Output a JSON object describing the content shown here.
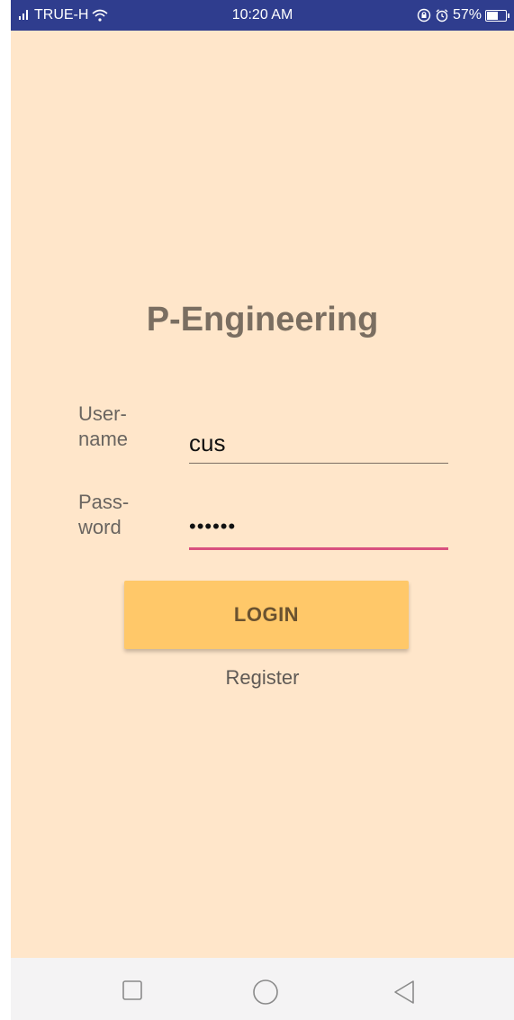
{
  "status_bar": {
    "carrier": "TRUE-H",
    "time": "10:20 AM",
    "battery": "57%",
    "icons": [
      "signal-icon",
      "wifi-icon",
      "lock-rotate-icon",
      "alarm-icon",
      "battery-icon"
    ],
    "background": "#2f3d8e"
  },
  "app": {
    "title": "P-Engineering",
    "username": {
      "label": "User-\nname",
      "value": "cus"
    },
    "password": {
      "label": "Pass-\nword",
      "value": "••••••"
    },
    "login_label": "LOGIN",
    "register_label": "Register",
    "colors": {
      "background": "#ffe6ca",
      "button": "#ffc869",
      "focused_underline": "#d9507f"
    }
  },
  "nav_bar": {
    "buttons": [
      "square-recents-icon",
      "circle-home-icon",
      "triangle-back-icon"
    ]
  }
}
